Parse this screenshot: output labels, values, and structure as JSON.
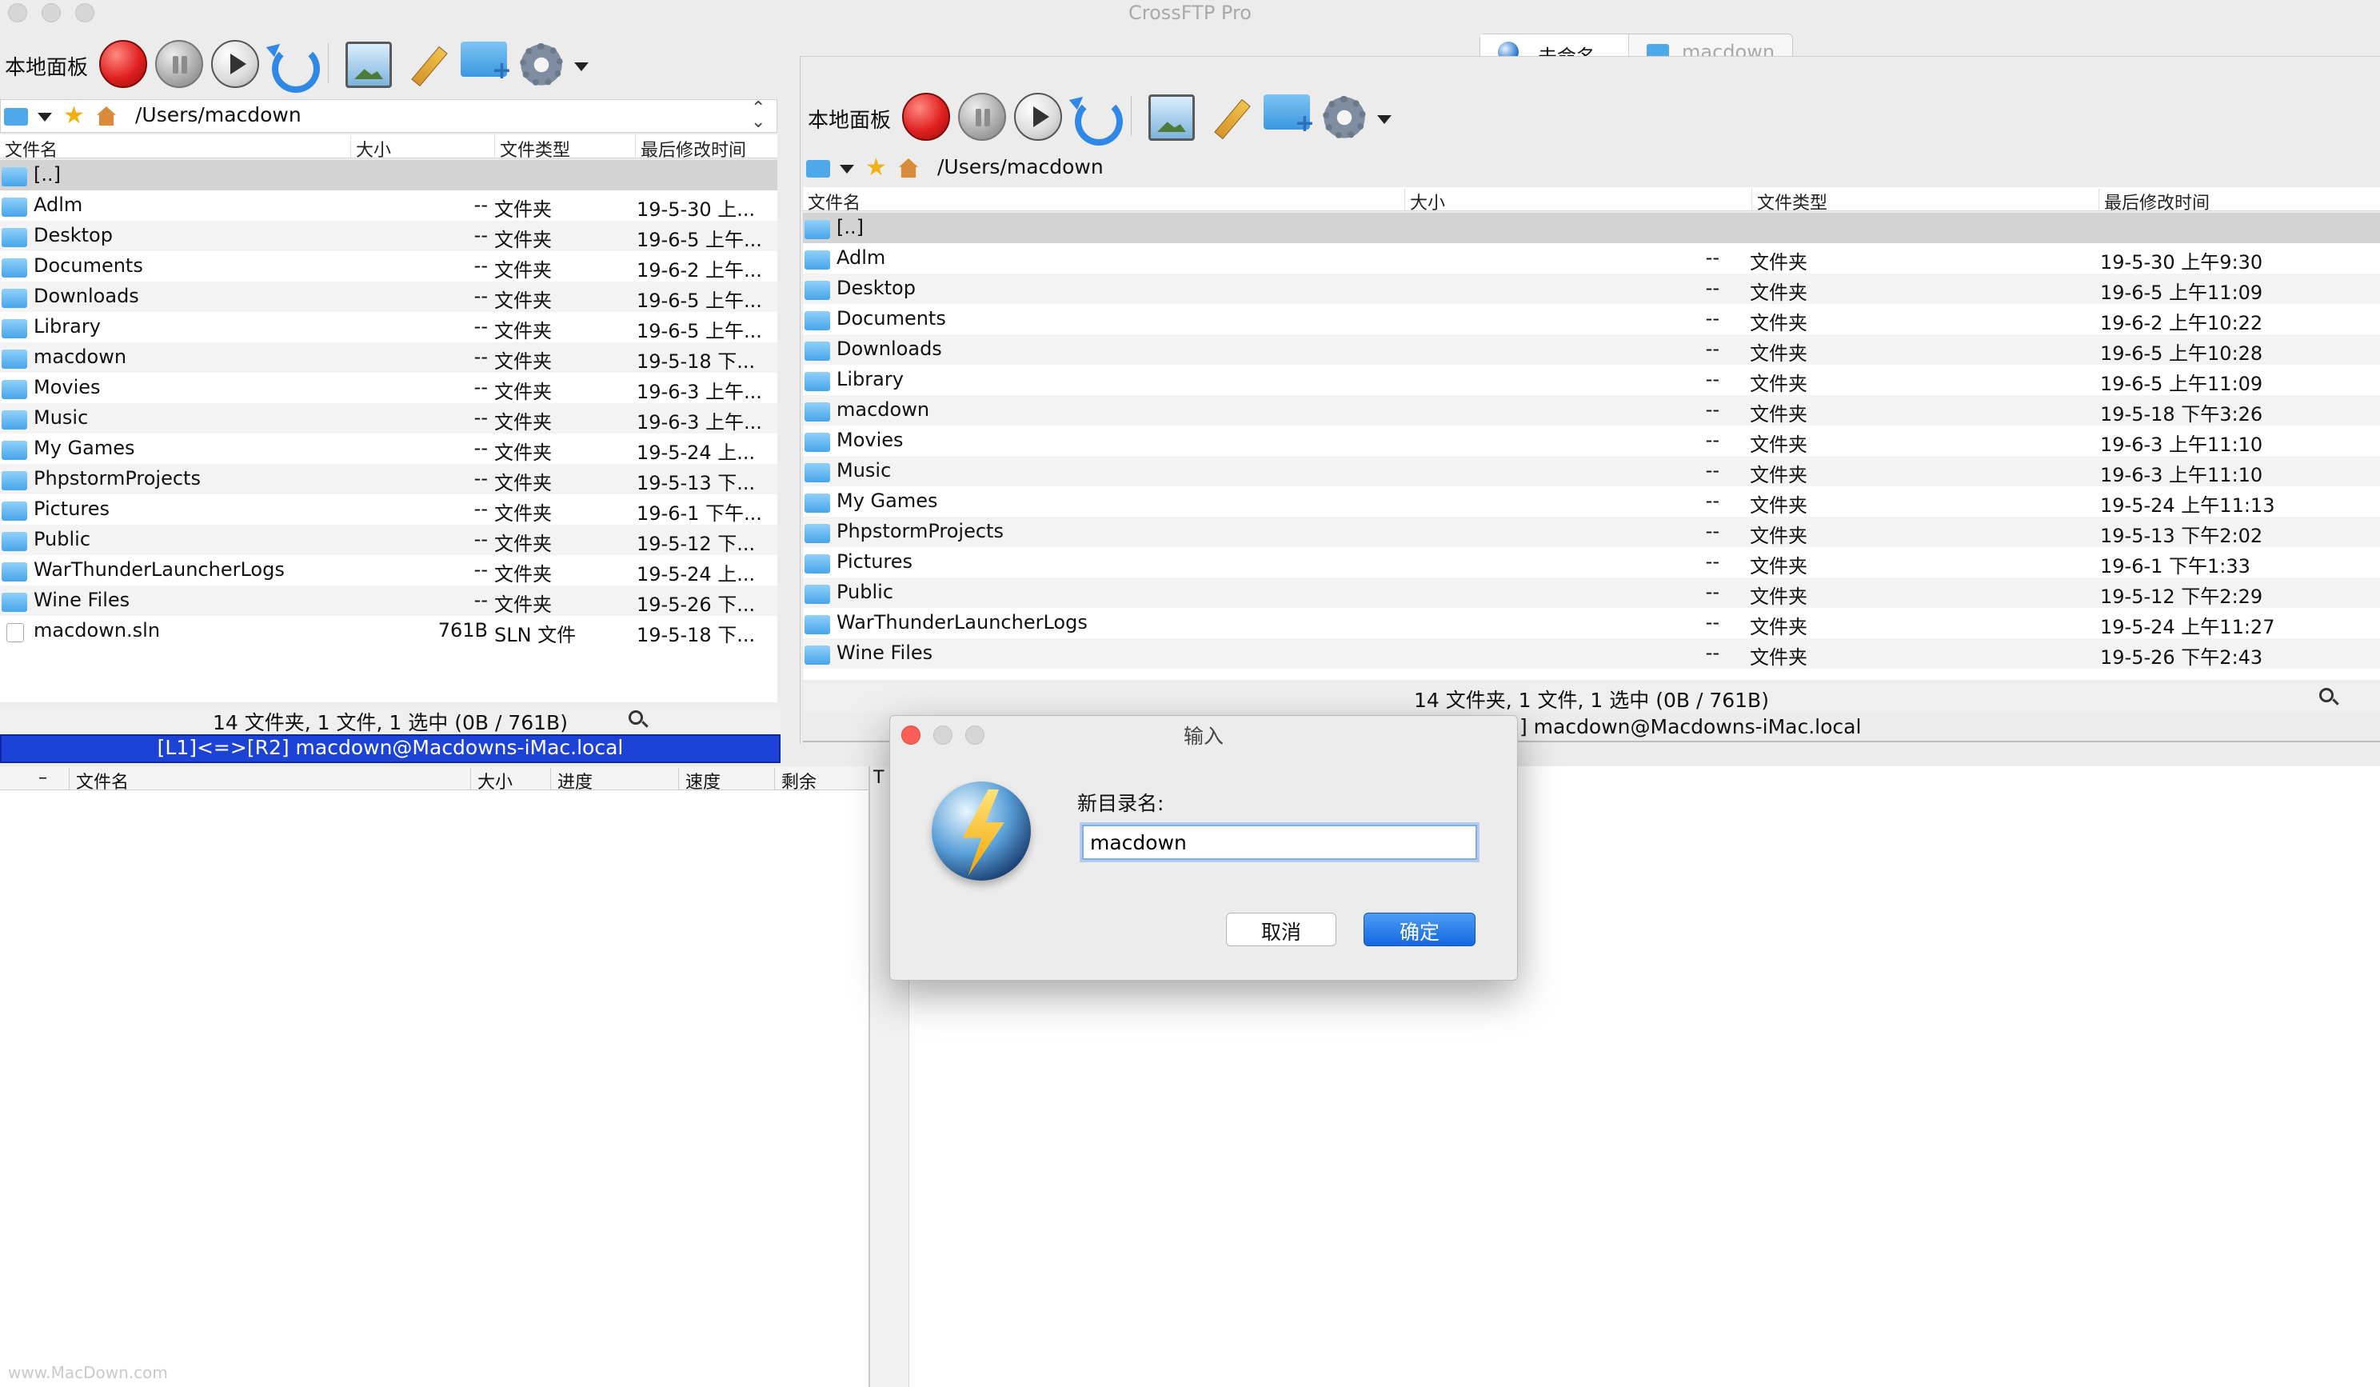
{
  "window": {
    "title": "CrossFTP Pro",
    "tabs": [
      {
        "label": "未命名",
        "icon": "globe-icon",
        "active": true
      },
      {
        "label": "macdown",
        "icon": "folder-icon",
        "active": false
      }
    ]
  },
  "left_panel": {
    "toolbar_label": "本地面板",
    "path": "/Users/macdown",
    "columns": [
      "文件名",
      "大小",
      "文件类型",
      "最后修改时间"
    ],
    "rows": [
      {
        "name": "[..]",
        "size": "",
        "type": "",
        "date": ""
      },
      {
        "name": "Adlm",
        "size": "--",
        "type": "文件夹",
        "date": "19-5-30 上..."
      },
      {
        "name": "Desktop",
        "size": "--",
        "type": "文件夹",
        "date": "19-6-5 上午..."
      },
      {
        "name": "Documents",
        "size": "--",
        "type": "文件夹",
        "date": "19-6-2 上午..."
      },
      {
        "name": "Downloads",
        "size": "--",
        "type": "文件夹",
        "date": "19-6-5 上午..."
      },
      {
        "name": "Library",
        "size": "--",
        "type": "文件夹",
        "date": "19-6-5 上午..."
      },
      {
        "name": "macdown",
        "size": "--",
        "type": "文件夹",
        "date": "19-5-18 下..."
      },
      {
        "name": "Movies",
        "size": "--",
        "type": "文件夹",
        "date": "19-6-3 上午..."
      },
      {
        "name": "Music",
        "size": "--",
        "type": "文件夹",
        "date": "19-6-3 上午..."
      },
      {
        "name": "My Games",
        "size": "--",
        "type": "文件夹",
        "date": "19-5-24 上..."
      },
      {
        "name": "PhpstormProjects",
        "size": "--",
        "type": "文件夹",
        "date": "19-5-13 下..."
      },
      {
        "name": "Pictures",
        "size": "--",
        "type": "文件夹",
        "date": "19-6-1 下午..."
      },
      {
        "name": "Public",
        "size": "--",
        "type": "文件夹",
        "date": "19-5-12 下..."
      },
      {
        "name": "WarThunderLauncherLogs",
        "size": "--",
        "type": "文件夹",
        "date": "19-5-24 上..."
      },
      {
        "name": "Wine Files",
        "size": "--",
        "type": "文件夹",
        "date": "19-5-26 下..."
      },
      {
        "name": "macdown.sln",
        "size": "761B",
        "type": "SLN 文件",
        "date": "19-5-18 下..."
      }
    ],
    "status": "14 文件夹, 1 文件, 1 选中 (0B / 761B)",
    "session": "[L1]<=>[R2] macdown@Macdowns-iMac.local"
  },
  "right_panel": {
    "toolbar_label": "本地面板",
    "path": "/Users/macdown",
    "columns": [
      "文件名",
      "大小",
      "文件类型",
      "最后修改时间"
    ],
    "rows": [
      {
        "name": "[..]",
        "size": "",
        "type": "",
        "date": ""
      },
      {
        "name": "Adlm",
        "size": "--",
        "type": "文件夹",
        "date": "19-5-30 上午9:30"
      },
      {
        "name": "Desktop",
        "size": "--",
        "type": "文件夹",
        "date": "19-6-5 上午11:09"
      },
      {
        "name": "Documents",
        "size": "--",
        "type": "文件夹",
        "date": "19-6-2 上午10:22"
      },
      {
        "name": "Downloads",
        "size": "--",
        "type": "文件夹",
        "date": "19-6-5 上午10:28"
      },
      {
        "name": "Library",
        "size": "--",
        "type": "文件夹",
        "date": "19-6-5 上午11:09"
      },
      {
        "name": "macdown",
        "size": "--",
        "type": "文件夹",
        "date": "19-5-18 下午3:26"
      },
      {
        "name": "Movies",
        "size": "--",
        "type": "文件夹",
        "date": "19-6-3 上午11:10"
      },
      {
        "name": "Music",
        "size": "--",
        "type": "文件夹",
        "date": "19-6-3 上午11:10"
      },
      {
        "name": "My Games",
        "size": "--",
        "type": "文件夹",
        "date": "19-5-24 上午11:13"
      },
      {
        "name": "PhpstormProjects",
        "size": "--",
        "type": "文件夹",
        "date": "19-5-13 下午2:02"
      },
      {
        "name": "Pictures",
        "size": "--",
        "type": "文件夹",
        "date": "19-6-1 下午1:33"
      },
      {
        "name": "Public",
        "size": "--",
        "type": "文件夹",
        "date": "19-5-12 下午2:29"
      },
      {
        "name": "WarThunderLauncherLogs",
        "size": "--",
        "type": "文件夹",
        "date": "19-5-24 上午11:27"
      },
      {
        "name": "Wine Files",
        "size": "--",
        "type": "文件夹",
        "date": "19-5-26 下午2:43"
      }
    ],
    "status": "14 文件夹, 1 文件, 1 选中 (0B / 761B)",
    "session_partial": ".] macdown@Macdowns-iMac.local"
  },
  "queue": {
    "columns": [
      "–",
      "文件名",
      "大小",
      "进度",
      "速度",
      "剩余",
      "T"
    ]
  },
  "dialog": {
    "title": "输入",
    "label": "新目录名:",
    "value": "macdown",
    "cancel": "取消",
    "ok": "确定"
  },
  "watermark": "www.MacDown.com",
  "colors": {
    "session_bar": "#1c42d6",
    "ok_button": "#1467e1",
    "folder": "#47a5ea"
  }
}
